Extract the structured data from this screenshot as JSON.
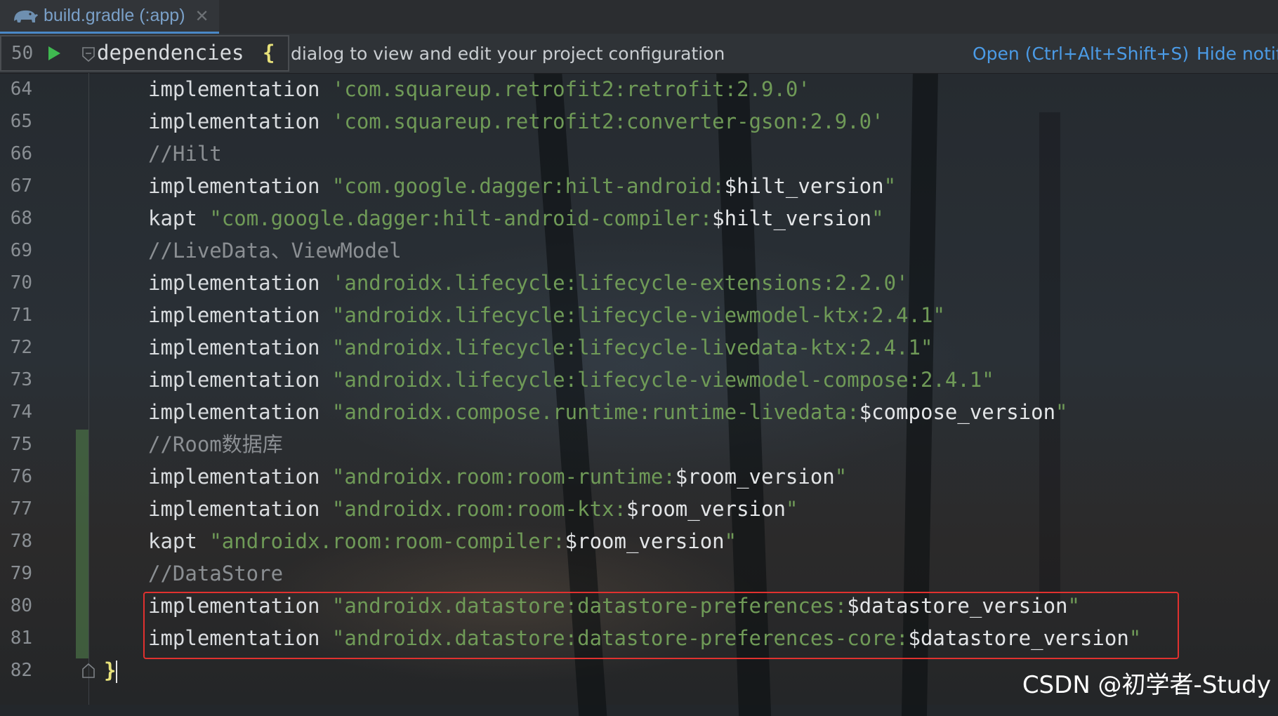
{
  "tab": {
    "label": "build.gradle (:app)",
    "close_glyph": "✕",
    "icon": "gradle-elephant-icon"
  },
  "notification": {
    "text": "dialog to view and edit your project configuration",
    "open_link": "Open (Ctrl+Alt+Shift+S)",
    "hide_link": "Hide notif"
  },
  "sticky_line": {
    "number": "50",
    "text": "dependencies",
    "brace": "{"
  },
  "lines": [
    {
      "num": "64",
      "kind": "impl",
      "kw": "implementation",
      "q": "'",
      "str": "com.squareup.retrofit2:retrofit:2.9.0",
      "var": "",
      "end": "'"
    },
    {
      "num": "65",
      "kind": "impl",
      "kw": "implementation",
      "q": "'",
      "str": "com.squareup.retrofit2:converter-gson:2.9.0",
      "var": "",
      "end": "'"
    },
    {
      "num": "66",
      "kind": "comment",
      "text": "//Hilt"
    },
    {
      "num": "67",
      "kind": "impl",
      "kw": "implementation",
      "q": "\"",
      "str": "com.google.dagger:hilt-android:",
      "var": "$hilt_version",
      "end": "\""
    },
    {
      "num": "68",
      "kind": "impl",
      "kw": "kapt",
      "q": "\"",
      "str": "com.google.dagger:hilt-android-compiler:",
      "var": "$hilt_version",
      "end": "\""
    },
    {
      "num": "69",
      "kind": "comment",
      "text": "//LiveData、ViewModel"
    },
    {
      "num": "70",
      "kind": "impl",
      "kw": "implementation",
      "q": "'",
      "str": "androidx.lifecycle:lifecycle-extensions:2.2.0",
      "var": "",
      "end": "'"
    },
    {
      "num": "71",
      "kind": "impl",
      "kw": "implementation",
      "q": "\"",
      "str": "androidx.lifecycle:lifecycle-viewmodel-ktx:2.4.1",
      "var": "",
      "end": "\""
    },
    {
      "num": "72",
      "kind": "impl",
      "kw": "implementation",
      "q": "\"",
      "str": "androidx.lifecycle:lifecycle-livedata-ktx:2.4.1",
      "var": "",
      "end": "\""
    },
    {
      "num": "73",
      "kind": "impl",
      "kw": "implementation",
      "q": "\"",
      "str": "androidx.lifecycle:lifecycle-viewmodel-compose:2.4.1",
      "var": "",
      "end": "\""
    },
    {
      "num": "74",
      "kind": "impl",
      "kw": "implementation",
      "q": "\"",
      "str": "androidx.compose.runtime:runtime-livedata:",
      "var": "$compose_version",
      "end": "\""
    },
    {
      "num": "75",
      "kind": "comment",
      "text": "//Room数据库"
    },
    {
      "num": "76",
      "kind": "impl",
      "kw": "implementation",
      "q": "\"",
      "str": "androidx.room:room-runtime:",
      "var": "$room_version",
      "end": "\""
    },
    {
      "num": "77",
      "kind": "impl",
      "kw": "implementation",
      "q": "\"",
      "str": "androidx.room:room-ktx:",
      "var": "$room_version",
      "end": "\""
    },
    {
      "num": "78",
      "kind": "impl",
      "kw": "kapt",
      "q": "\"",
      "str": "androidx.room:room-compiler:",
      "var": "$room_version",
      "end": "\""
    },
    {
      "num": "79",
      "kind": "comment",
      "text": "//DataStore"
    },
    {
      "num": "80",
      "kind": "impl",
      "kw": "implementation",
      "q": "\"",
      "str": "androidx.datastore:datastore-preferences:",
      "var": "$datastore_version",
      "end": "\""
    },
    {
      "num": "81",
      "kind": "impl",
      "kw": "implementation",
      "q": "\"",
      "str": "androidx.datastore:datastore-preferences-core:",
      "var": "$datastore_version",
      "end": "\""
    },
    {
      "num": "82",
      "kind": "close",
      "text": "}"
    }
  ],
  "watermark": "CSDN @初学者-Study",
  "colors": {
    "string": "#6f9a57",
    "keyword": "#d9dcdf",
    "comment": "#8b8f93",
    "link": "#4b9be6",
    "highlight_border": "#e0312f",
    "run_icon": "#3fb950"
  }
}
